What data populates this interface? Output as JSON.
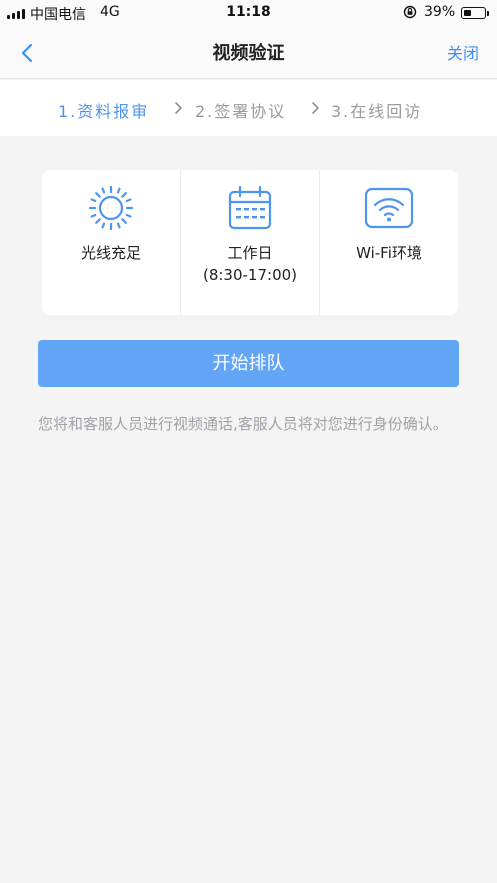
{
  "status_bar": {
    "carrier": "中国电信",
    "network": "4G",
    "time": "11:18",
    "battery": "39%",
    "battery_level": 0.39
  },
  "nav": {
    "title": "视频验证",
    "close_label": "关闭",
    "back_icon": "chevron-left-icon"
  },
  "steps": [
    {
      "label": "1.资料报审",
      "active": true
    },
    {
      "label": "2.签署协议",
      "active": false
    },
    {
      "label": "3.在线回访",
      "active": false
    }
  ],
  "requirements": [
    {
      "icon": "sun-icon",
      "label": "光线充足",
      "sub": ""
    },
    {
      "icon": "calendar-icon",
      "label": "工作日",
      "sub": "(8:30-17:00)"
    },
    {
      "icon": "wifi-icon",
      "label": "Wi-Fi环境",
      "sub": ""
    }
  ],
  "queue_button": "开始排队",
  "notice": "您将和客服人员进行视频通话,客服人员将对您进行身份确认。",
  "colors": {
    "accent": "#3c8ef5",
    "active_step": "#4e95f0",
    "button": "#62a5f6",
    "icon": "#4e95f0",
    "background": "#f4f4f5"
  }
}
